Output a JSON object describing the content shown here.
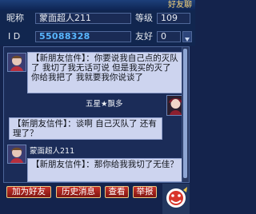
{
  "window": {
    "title": "好友聊"
  },
  "profile": {
    "nickname_label": "昵称",
    "nickname": "蒙面超人211",
    "level_label": "等级",
    "level": "109",
    "id_label": "I D",
    "id_value": "55088328",
    "friend_label": "友好",
    "friend_value": "0"
  },
  "messages": [
    {
      "text": "【新朋友信件】：你要说我自己点的灭队了 我切了我无话可说 但是我买的灭了你给我把了 我就要我你说谈了"
    },
    {
      "sender": "五星★飘多",
      "text": "【新朋友信件】：谈啊 自己灭队了 还有理了？"
    },
    {
      "sender": "蒙面超人211",
      "text": "【新朋友信件】：那你给我我切了无佳？"
    }
  ],
  "buttons": {
    "add_friend": "加为好友",
    "history": "历史消息",
    "view": "查看",
    "report": "举报"
  },
  "colors": {
    "window_bg": "#14234c",
    "bubble_bg": "#cdd4ef",
    "button_red": "#c7332a",
    "id_blue": "#59b7ff"
  }
}
